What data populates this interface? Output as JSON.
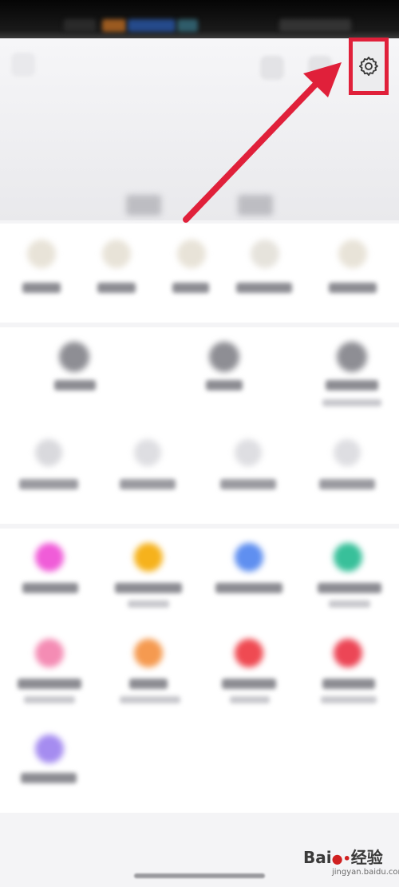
{
  "icons": {
    "settings": "gear-icon"
  },
  "colors": {
    "highlight": "#e0203a",
    "arrow": "#e0203a",
    "card": "#ffffff",
    "page": "#f4f4f6"
  },
  "watermark": {
    "brand_prefix": "Bai",
    "brand_suffix": "经验",
    "url": "jingyan.baidu.com"
  }
}
